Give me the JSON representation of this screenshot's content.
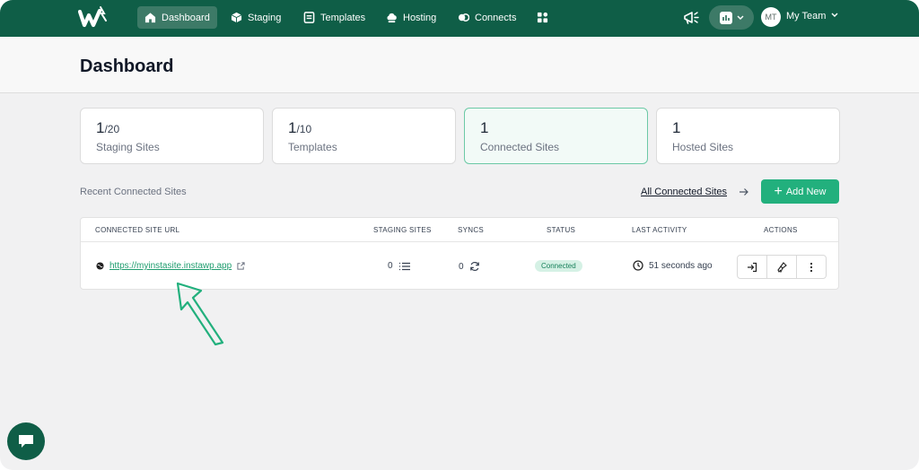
{
  "nav": {
    "items": [
      {
        "label": "Dashboard",
        "icon": "home-icon",
        "active": true
      },
      {
        "label": "Staging",
        "icon": "cube-icon",
        "active": false
      },
      {
        "label": "Templates",
        "icon": "templates-icon",
        "active": false
      },
      {
        "label": "Hosting",
        "icon": "cloud-icon",
        "active": false
      },
      {
        "label": "Connects",
        "icon": "connects-icon",
        "active": false
      },
      {
        "label": "",
        "icon": "apps-grid-icon",
        "active": false
      }
    ],
    "avatar_initials": "MT",
    "team_label": "My Team"
  },
  "header": {
    "title": "Dashboard"
  },
  "stats": [
    {
      "value": "1",
      "of": "/20",
      "label": "Staging Sites",
      "selected": false
    },
    {
      "value": "1",
      "of": "/10",
      "label": "Templates",
      "selected": false
    },
    {
      "value": "1",
      "of": "",
      "label": "Connected Sites",
      "selected": true
    },
    {
      "value": "1",
      "of": "",
      "label": "Hosted Sites",
      "selected": false
    }
  ],
  "section": {
    "label": "Recent Connected Sites",
    "all_link": "All Connected Sites",
    "add_button": "Add New"
  },
  "table": {
    "headers": [
      "CONNECTED SITE URL",
      "STAGING SITES",
      "SYNCS",
      "STATUS",
      "LAST ACTIVITY",
      "ACTIONS"
    ],
    "rows": [
      {
        "url": "https://myinstasite.instawp.app",
        "staging_sites": "0",
        "syncs": "0",
        "status": "Connected",
        "last_activity": "51 seconds ago"
      }
    ]
  },
  "colors": {
    "nav_bg": "#0f5e47",
    "accent": "#22b07d",
    "badge_bg": "#d5f1e5"
  }
}
